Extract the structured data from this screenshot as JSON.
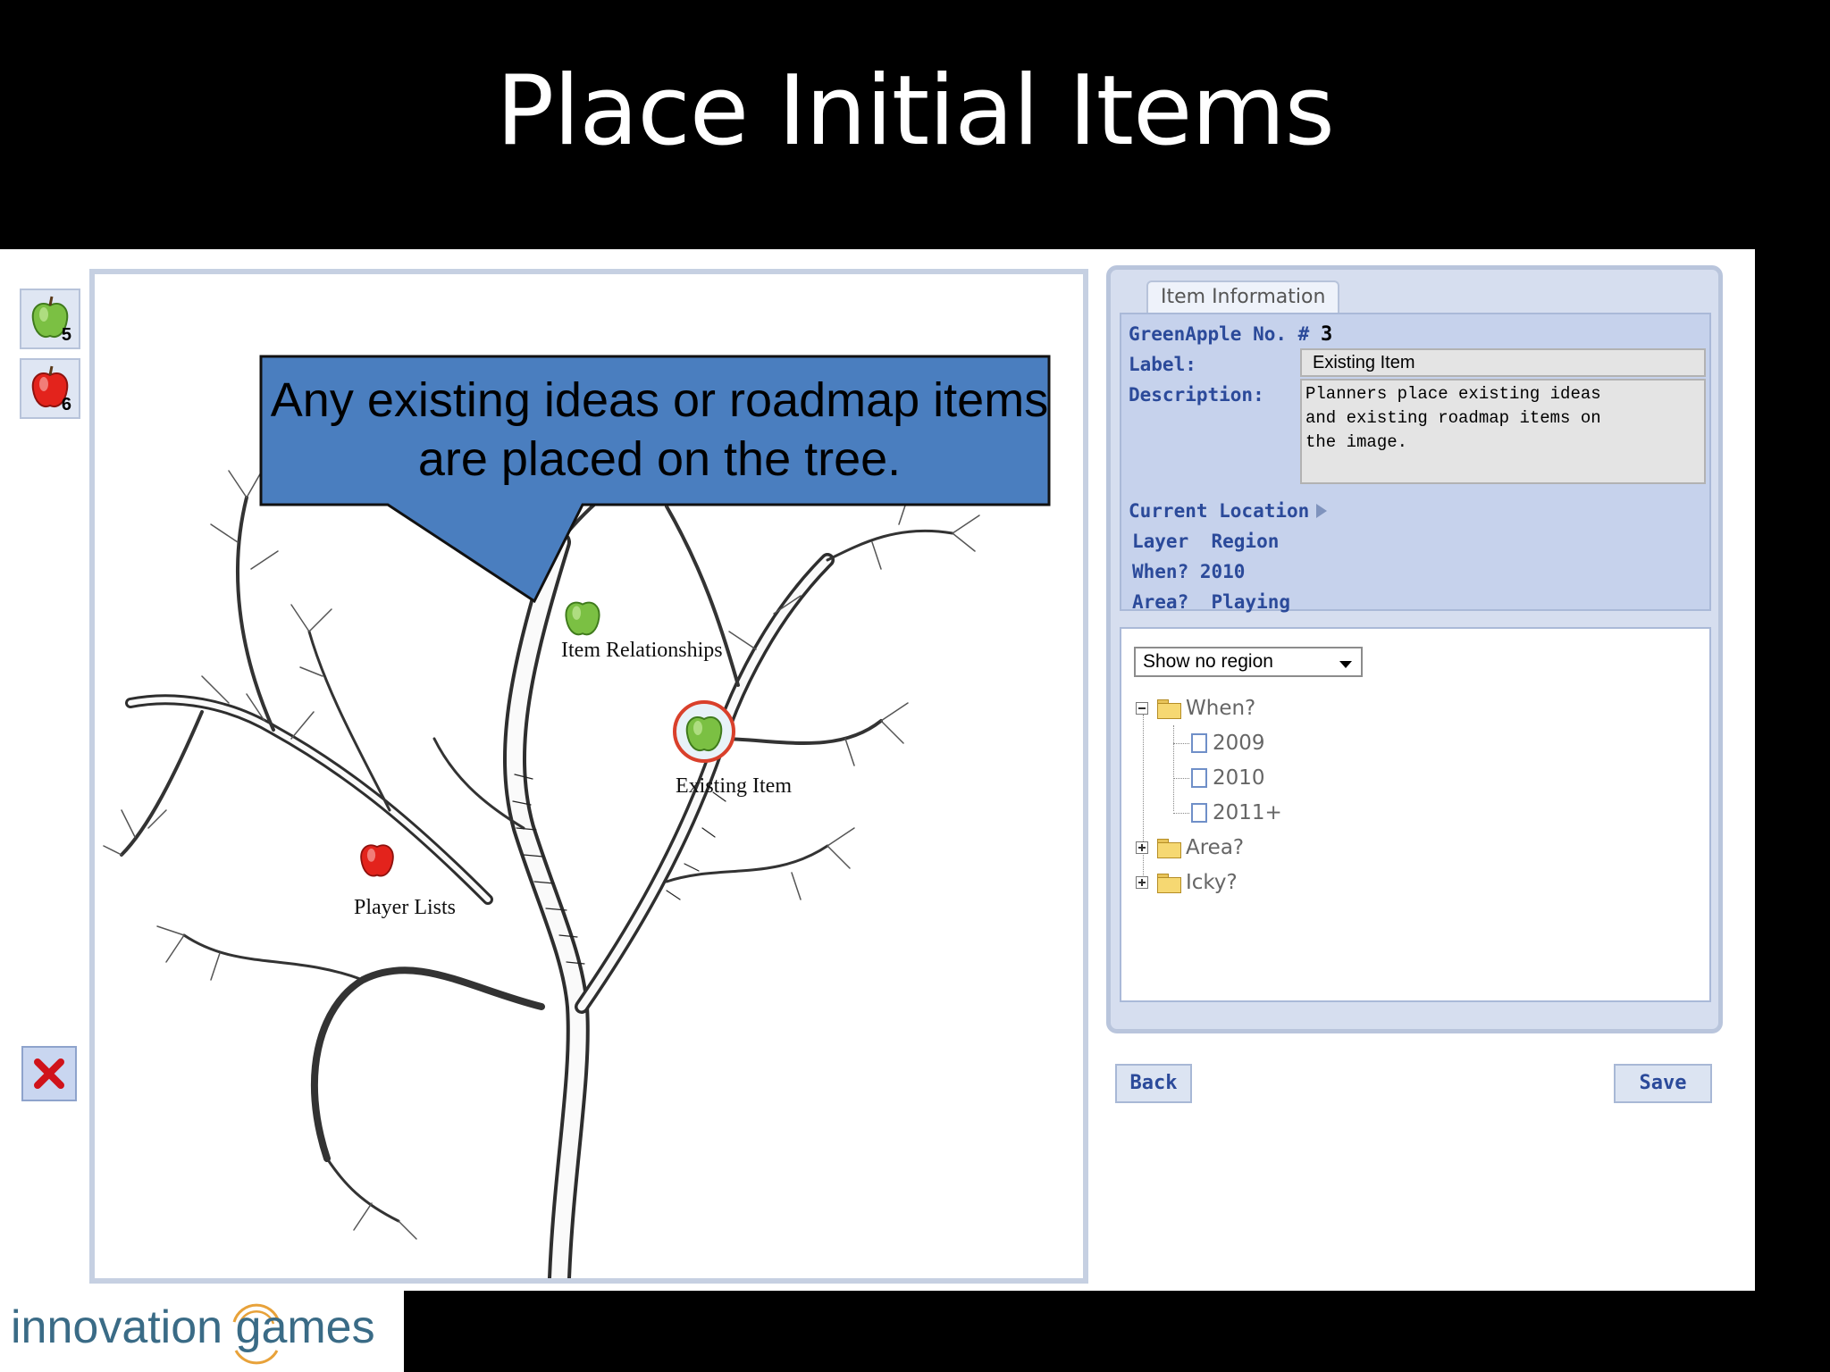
{
  "slide": {
    "title": "Place Initial Items"
  },
  "palette": {
    "green_count": "5",
    "red_count": "6"
  },
  "callout": {
    "text": "Any existing ideas or roadmap items are placed on the tree."
  },
  "apples": [
    {
      "label": "Item Relationships",
      "color": "green"
    },
    {
      "label": "Existing Item",
      "color": "green",
      "selected": true
    },
    {
      "label": "Player Lists",
      "color": "red"
    }
  ],
  "panel": {
    "tab": "Item Information",
    "item_type": "GreenApple No. #",
    "item_number": "3",
    "label_caption": "Label:",
    "label_value": "Existing Item",
    "description_caption": "Description:",
    "description_value": "Planners place existing ideas\nand existing roadmap items on\nthe image.",
    "current_location": "Current Location",
    "layer": "Layer  Region",
    "when": "When? 2010",
    "area": "Area?  Playing"
  },
  "region_tree": {
    "select_value": "Show no region",
    "nodes": {
      "when": "When?",
      "y2009": "2009",
      "y2010": "2010",
      "y2011": "2011+",
      "area": "Area?",
      "icky": "Icky?"
    }
  },
  "buttons": {
    "back": "Back",
    "save": "Save"
  },
  "logo": {
    "text": "innovation games"
  },
  "colors": {
    "panel_label": "#2b4a9a",
    "callout_fill": "#4a7ebf",
    "apple_green": "#7bc043",
    "apple_red": "#e3231c",
    "selection_ring": "#d9402b"
  }
}
